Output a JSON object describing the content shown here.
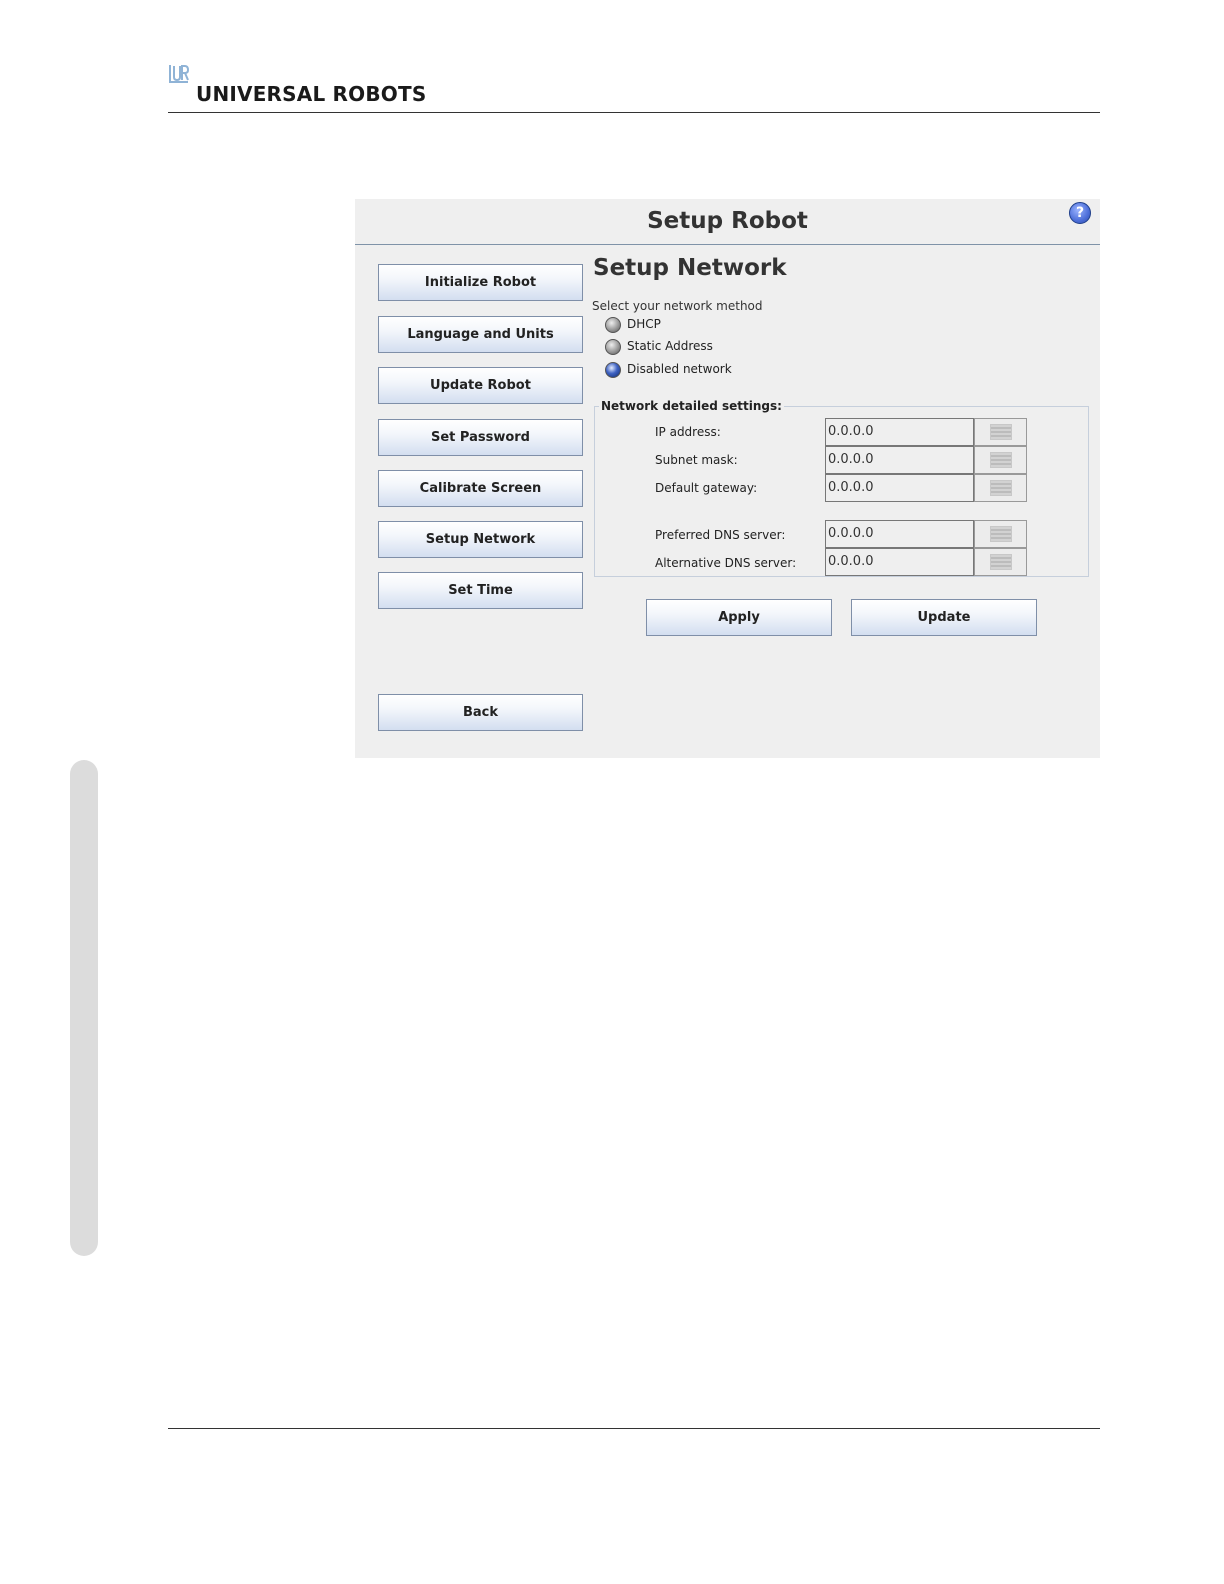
{
  "brand": {
    "name": "UNIVERSAL ROBOTS",
    "logo_icon": "ur-logo-icon"
  },
  "window": {
    "title": "Setup Robot",
    "help_icon": "question-mark-icon"
  },
  "nav": {
    "items": [
      {
        "label": "Initialize Robot"
      },
      {
        "label": "Language and Units"
      },
      {
        "label": "Update Robot"
      },
      {
        "label": "Set Password"
      },
      {
        "label": "Calibrate Screen"
      },
      {
        "label": "Setup Network"
      },
      {
        "label": "Set Time"
      }
    ],
    "back_label": "Back"
  },
  "network": {
    "title": "Setup Network",
    "method_label": "Select your network method",
    "methods": [
      {
        "label": "DHCP",
        "selected": false
      },
      {
        "label": "Static Address",
        "selected": false
      },
      {
        "label": "Disabled network",
        "selected": true
      }
    ],
    "details_legend": "Network detailed settings:",
    "fields": [
      {
        "label": "IP address:",
        "value": "0.0.0.0"
      },
      {
        "label": "Subnet mask:",
        "value": "0.0.0.0"
      },
      {
        "label": "Default gateway:",
        "value": "0.0.0.0"
      },
      {
        "label": "Preferred DNS server:",
        "value": "0.0.0.0"
      },
      {
        "label": "Alternative DNS server:",
        "value": "0.0.0.0"
      }
    ],
    "field_button_icon": "keyboard-icon",
    "apply_label": "Apply",
    "update_label": "Update"
  }
}
